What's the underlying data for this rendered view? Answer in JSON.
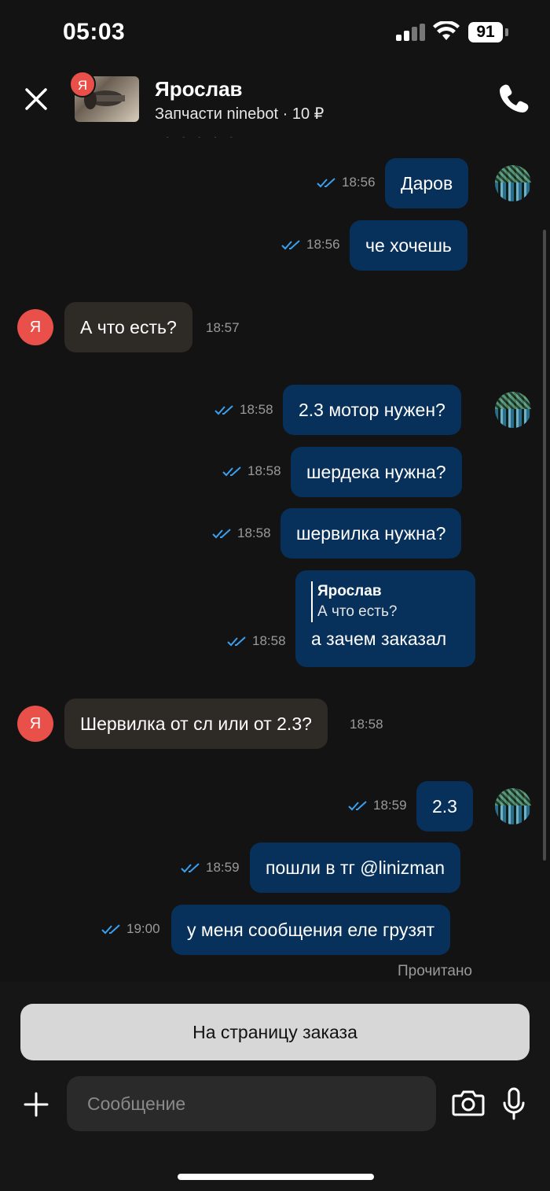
{
  "status": {
    "time": "05:03",
    "battery": "91"
  },
  "header": {
    "contact_name": "Ярослав",
    "listing_subtitle": "Запчасти ninebot · 10 ₽",
    "badge_letter": "Я"
  },
  "messages": {
    "m1": {
      "text": "Даров",
      "time": "18:56"
    },
    "m2": {
      "text": "че хочешь",
      "time": "18:56"
    },
    "m3": {
      "text": "А что есть?",
      "time": "18:57"
    },
    "m4": {
      "text": "2.3 мотор нужен?",
      "time": "18:58"
    },
    "m5": {
      "text": "шердека нужна?",
      "time": "18:58"
    },
    "m6": {
      "text": "шервилка нужна?",
      "time": "18:58"
    },
    "m7": {
      "reply_name": "Ярослав",
      "reply_text": "А что есть?",
      "text": "а зачем заказал",
      "time": "18:58"
    },
    "m8": {
      "text": "Шервилка от сл или от 2.3?",
      "time": "18:58"
    },
    "m9": {
      "text": "2.3",
      "time": "18:59"
    },
    "m10": {
      "text": "пошли в тг @linizman",
      "time": "18:59"
    },
    "m11": {
      "text": "у меня сообщения еле грузят",
      "time": "19:00"
    },
    "read_label": "Прочитано"
  },
  "avatar_letter": "Я",
  "footer": {
    "order_button": "На страницу заказа",
    "input_placeholder": "Сообщение"
  },
  "colors": {
    "outgoing_bubble": "#07305a",
    "incoming_bubble": "#2e2a26",
    "avatar_red": "#e9504a",
    "ticks_blue": "#3aa0f0"
  }
}
